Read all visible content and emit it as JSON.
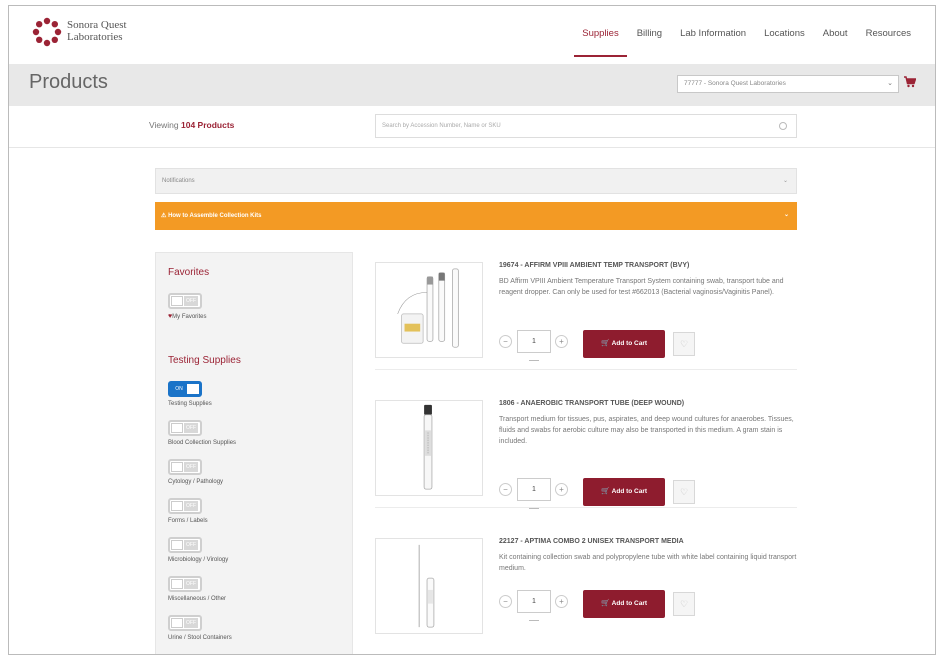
{
  "brand": {
    "name_line1": "Sonora Quest",
    "name_line2": "Laboratories"
  },
  "nav": {
    "items": [
      {
        "label": "Supplies",
        "active": true
      },
      {
        "label": "Billing",
        "active": false
      },
      {
        "label": "Lab Information",
        "active": false
      },
      {
        "label": "Locations",
        "active": false
      },
      {
        "label": "About",
        "active": false
      },
      {
        "label": "Resources",
        "active": false
      }
    ]
  },
  "titlebar": {
    "title": "Products",
    "account_selected": "77777 - Sonora Quest Laboratories"
  },
  "viewbar": {
    "viewing_prefix": "Viewing",
    "viewing_count": "104 Products",
    "search_placeholder": "Search by Accession Number, Name or SKU"
  },
  "notifications": {
    "label": "Notifications"
  },
  "alert": {
    "label": "How to Assemble Collection Kits"
  },
  "filters": {
    "favorites_heading": "Favorites",
    "testing_heading": "Testing Supplies",
    "toggle_off_text": "OFF",
    "toggle_on_text": "ON",
    "items": [
      {
        "label": "My Favorites",
        "on": false,
        "heart": true
      },
      {
        "label": "Testing Supplies",
        "on": true,
        "heart": false
      },
      {
        "label": "Blood Collection Supplies",
        "on": false,
        "heart": false
      },
      {
        "label": "Cytology / Pathology",
        "on": false,
        "heart": false
      },
      {
        "label": "Forms / Labels",
        "on": false,
        "heart": false
      },
      {
        "label": "Microbiology / Virology",
        "on": false,
        "heart": false
      },
      {
        "label": "Miscellaneous / Other",
        "on": false,
        "heart": false
      },
      {
        "label": "Urine / Stool Containers",
        "on": false,
        "heart": false
      }
    ]
  },
  "products": [
    {
      "title": "19674 - AFFIRM VPIII AMBIENT TEMP TRANSPORT (BVY)",
      "description": "BD Affirm VPIII Ambient Temperature Transport System containing swab, transport tube and reagent dropper. Can only be used for test #662013 (Bacterial vaginosis/Vaginitis Panel).",
      "qty": "1",
      "add_label": "Add to Cart"
    },
    {
      "title": "1806 - ANAEROBIC TRANSPORT TUBE (DEEP WOUND)",
      "description": "Transport medium for tissues, pus, aspirates, and deep wound cultures for anaerobes. Tissues, fluids and swabs for aerobic culture may also be transported in this medium. A gram stain is included.",
      "qty": "1",
      "add_label": "Add to Cart"
    },
    {
      "title": "22127 - APTIMA COMBO 2 UNISEX TRANSPORT MEDIA",
      "description": "Kit containing collection swab and polypropylene tube with white label containing liquid transport medium.",
      "qty": "1",
      "add_label": "Add to Cart"
    }
  ],
  "icons": {
    "cart": "cart-icon",
    "heart": "heart-icon",
    "search": "search-icon"
  },
  "colors": {
    "brand": "#9b2335",
    "add_to_cart": "#8e1c2e",
    "alert": "#f39a24",
    "toggle_on": "#1a73c8"
  }
}
